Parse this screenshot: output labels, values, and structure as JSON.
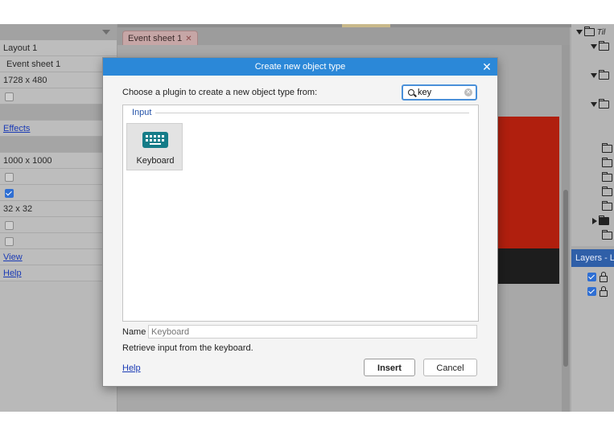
{
  "properties": {
    "rows": [
      {
        "text": "Layout 1"
      },
      {
        "text": "Event sheet 1"
      },
      {
        "text": "1728 x 480"
      },
      {
        "checkbox": false
      },
      {
        "empty": true
      },
      {
        "link": "Effects"
      },
      {
        "empty": true
      },
      {
        "text": "1000 x 1000"
      },
      {
        "checkbox": false
      },
      {
        "checkbox": true
      },
      {
        "text": "32 x 32"
      },
      {
        "checkbox": false
      },
      {
        "checkbox": false
      },
      {
        "link": "View"
      },
      {
        "link": "Help"
      }
    ]
  },
  "editor": {
    "tab_label": "Event sheet 1",
    "tab_close": "✕"
  },
  "project_tree": {
    "root_label": "Til"
  },
  "layers": {
    "header": "Layers - L"
  },
  "dialog": {
    "title": "Create new object type",
    "close_glyph": "✕",
    "prompt": "Choose a plugin to create a new object type from:",
    "search": {
      "value": "key",
      "clear_glyph": "✕"
    },
    "category": "Input",
    "plugins": [
      {
        "name": "Keyboard",
        "icon": "keyboard-icon"
      }
    ],
    "name_label": "Name",
    "name_placeholder": "Keyboard",
    "description": "Retrieve input from the keyboard.",
    "help_label": "Help",
    "insert_label": "Insert",
    "cancel_label": "Cancel"
  },
  "colors": {
    "title_bar": "#2b88d8",
    "category": "#2352a8",
    "keyboard_icon": "#157c88",
    "layers_header": "#2f5fa8"
  }
}
